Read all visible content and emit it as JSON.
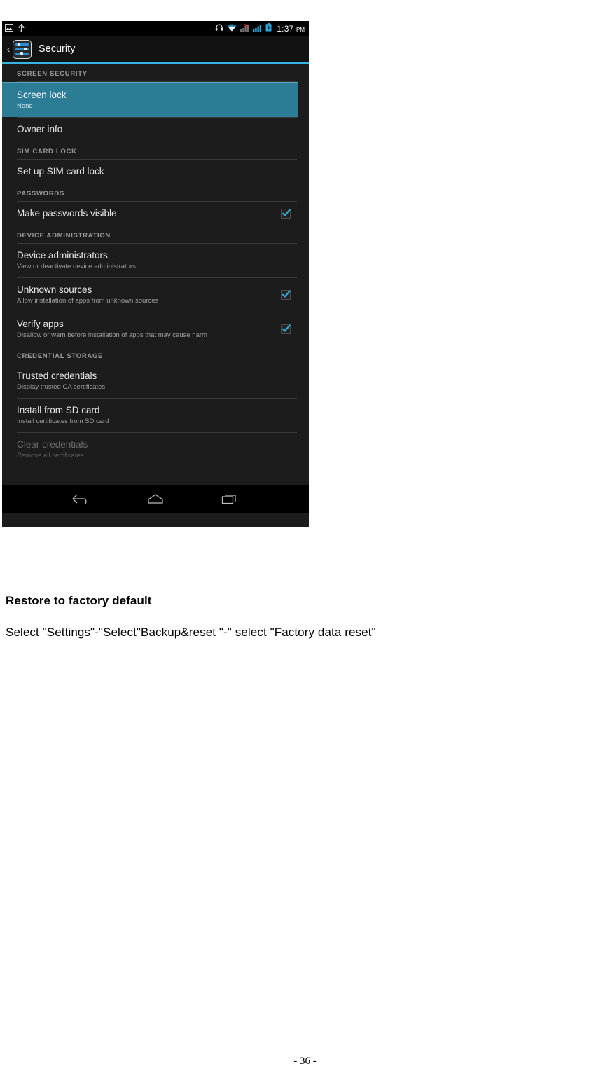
{
  "document": {
    "heading": "Restore to factory default",
    "paragraph": "Select \"Settings\"-\"Select\"Backup&reset \"-\" select \"Factory data reset\"",
    "page_number": "- 36 -"
  },
  "screenshot": {
    "status_bar": {
      "left_icons": [
        "screenshot-icon",
        "usb-icon"
      ],
      "right_icons": [
        "headset-icon",
        "wifi-icon",
        "no-sim-signal-icon",
        "cellular-signal-icon",
        "battery-icon"
      ],
      "time": "1:37",
      "meridiem": "PM"
    },
    "action_bar": {
      "back_chevron": "‹",
      "app_icon": "settings-sliders-icon",
      "title": "Security"
    },
    "colors": {
      "accent": "#33b5e5",
      "highlight": "#2d7c96",
      "background": "#1c1c1c",
      "checkbox_check": "#33b5e5"
    },
    "sections": [
      {
        "header": "SCREEN SECURITY",
        "rows": [
          {
            "title": "Screen lock",
            "subtitle": "None",
            "highlighted": true,
            "checkbox": null,
            "disabled": false
          },
          {
            "title": "Owner info",
            "subtitle": null,
            "highlighted": false,
            "checkbox": null,
            "disabled": false
          }
        ]
      },
      {
        "header": "SIM CARD LOCK",
        "rows": [
          {
            "title": "Set up SIM card lock",
            "subtitle": null,
            "highlighted": false,
            "checkbox": null,
            "disabled": false
          }
        ]
      },
      {
        "header": "PASSWORDS",
        "rows": [
          {
            "title": "Make passwords visible",
            "subtitle": null,
            "highlighted": false,
            "checkbox": true,
            "disabled": false
          }
        ]
      },
      {
        "header": "DEVICE ADMINISTRATION",
        "rows": [
          {
            "title": "Device administrators",
            "subtitle": "View or deactivate device administrators",
            "highlighted": false,
            "checkbox": null,
            "disabled": false
          },
          {
            "title": "Unknown sources",
            "subtitle": "Allow installation of apps from unknown sources",
            "highlighted": false,
            "checkbox": true,
            "disabled": false
          },
          {
            "title": "Verify apps",
            "subtitle": "Disallow or warn before installation of apps that may cause harm",
            "highlighted": false,
            "checkbox": true,
            "disabled": false
          }
        ]
      },
      {
        "header": "CREDENTIAL STORAGE",
        "rows": [
          {
            "title": "Trusted credentials",
            "subtitle": "Display trusted CA certificates",
            "highlighted": false,
            "checkbox": null,
            "disabled": false
          },
          {
            "title": "Install from SD card",
            "subtitle": "Install certificates from SD card",
            "highlighted": false,
            "checkbox": null,
            "disabled": false
          },
          {
            "title": "Clear credentials",
            "subtitle": "Remove all certificates",
            "highlighted": false,
            "checkbox": null,
            "disabled": true
          }
        ]
      }
    ],
    "nav_bar": {
      "buttons": [
        "back-nav-icon",
        "home-nav-icon",
        "recents-nav-icon"
      ]
    }
  }
}
